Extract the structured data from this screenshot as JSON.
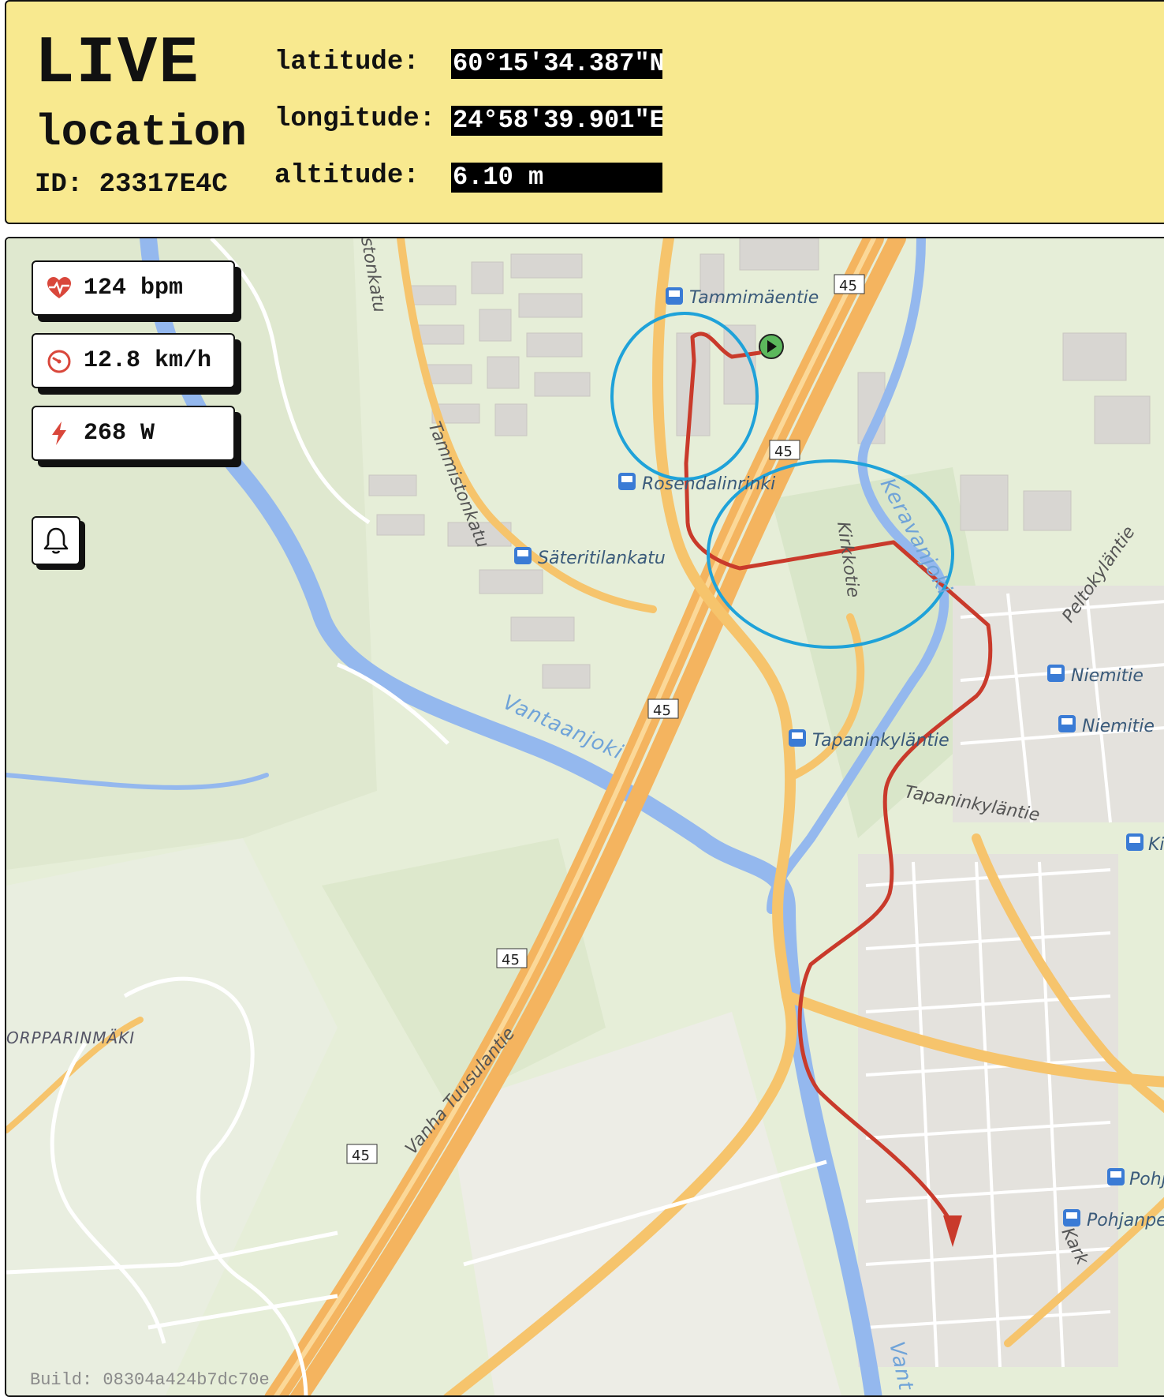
{
  "header": {
    "title_live": "LIVE",
    "title_location": "location",
    "device_id": "ID: 23317E4C",
    "latitude_label": "latitude:",
    "latitude_value": "60°15'34.387\"N",
    "longitude_label": "longitude:",
    "longitude_value": "24°58'39.901\"E",
    "altitude_label": "altitude:",
    "altitude_value": "6.10 m"
  },
  "metrics": {
    "heart_rate": "124 bpm",
    "speed": "12.8 km/h",
    "power": "268 W"
  },
  "icons": {
    "heart_rate": "heart-pulse-icon",
    "speed": "speedometer-icon",
    "power": "lightning-icon",
    "alerts": "bell-icon",
    "bus_stop": "bus-stop-icon",
    "start": "play-icon"
  },
  "map": {
    "bus_stops": [
      "Tammimäentie",
      "Rosendalinrinki",
      "Säteritilankatu",
      "Tapaninkyläntie",
      "Niemitie",
      "Niemitie",
      "Ki",
      "Pohja",
      "Pohjanpelto"
    ],
    "streets": [
      "stonkatu",
      "Tammistonkatu",
      "Kirkkotie",
      "Tapaninkyläntie",
      "Vanha Tuusulantie",
      "Peltokyläntie",
      "Kark"
    ],
    "rivers": [
      "Vantaanjoki",
      "Keravanjoki",
      "Vant"
    ],
    "areas": [
      "ORPPARINMÄKI"
    ],
    "highway_shields": [
      "45",
      "45",
      "45",
      "45",
      "45"
    ]
  },
  "colors": {
    "header_background": "#f8e98f",
    "route": "#c93a2b",
    "highlight_circle": "#1fa2d9",
    "water": "#94b8ee",
    "highway": "#f4b45f",
    "start_marker": "#5cb85c"
  },
  "build": "Build: 08304a424b7dc70e"
}
